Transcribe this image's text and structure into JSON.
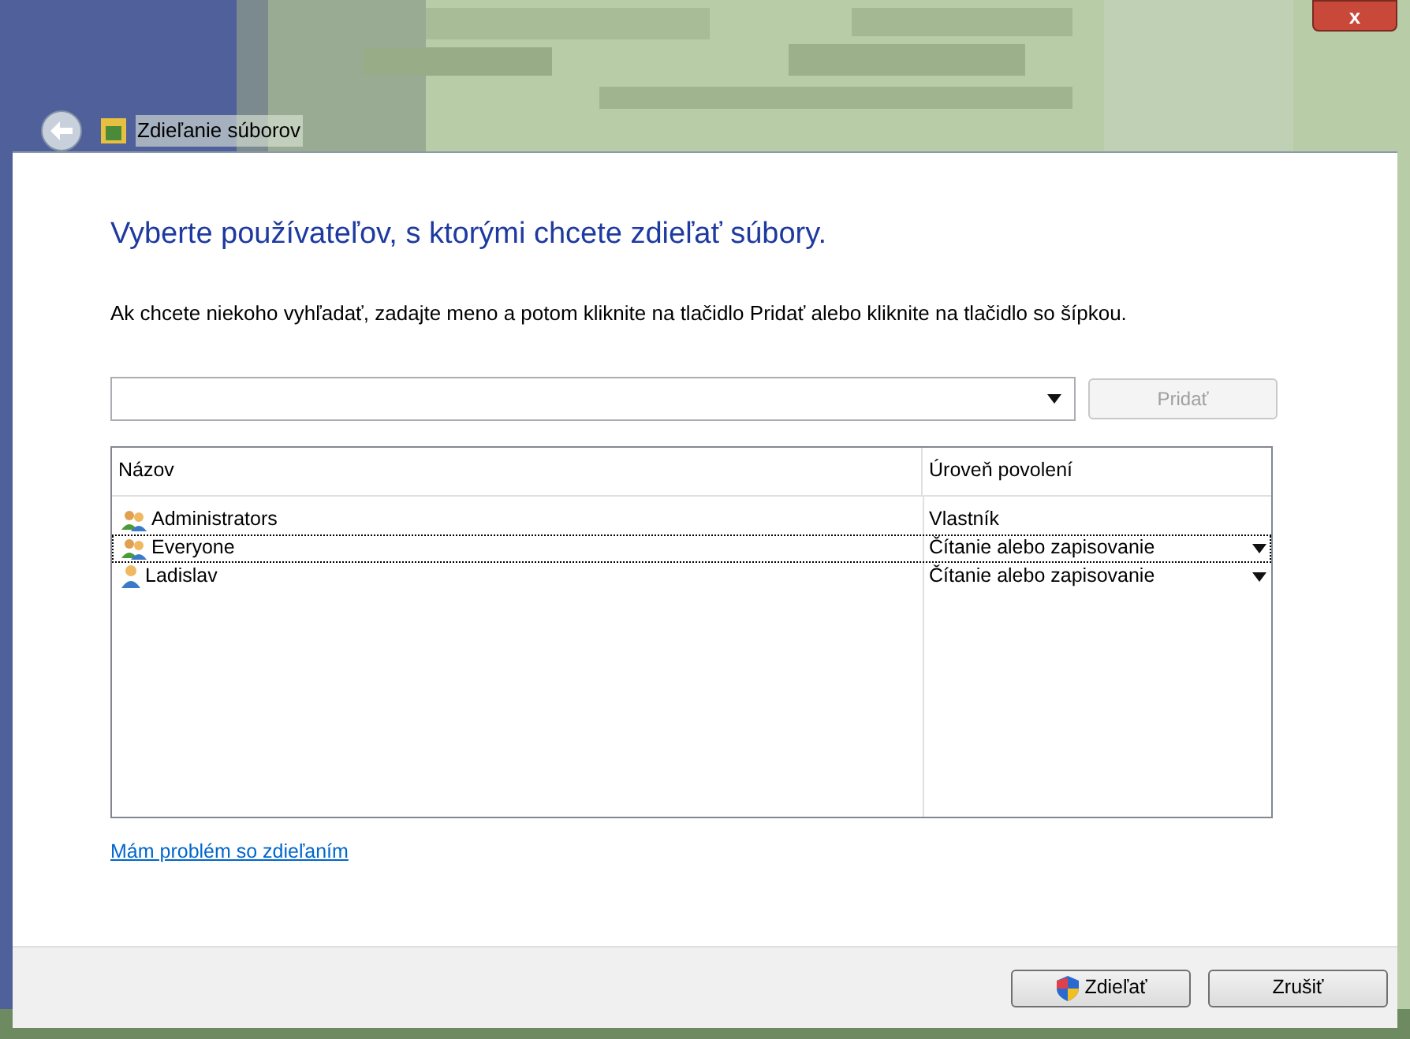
{
  "window": {
    "title": "Zdieľanie súborov",
    "close": "x"
  },
  "heading": "Vyberte používateľov, s ktorými chcete zdieľať súbory.",
  "instruction": "Ak chcete niekoho vyhľadať, zadajte meno a potom kliknite na tlačidlo Pridať alebo kliknite na tlačidlo so šípkou.",
  "add_button": {
    "label": "Pridať",
    "disabled": true
  },
  "table": {
    "columns": [
      "Názov",
      "Úroveň povolení"
    ],
    "rows": [
      {
        "name": "Administrators",
        "kind": "group",
        "permission": "Vlastník",
        "has_dropdown": false,
        "selected": false
      },
      {
        "name": "Everyone",
        "kind": "group",
        "permission": "Čítanie alebo zapisovanie",
        "has_dropdown": true,
        "selected": true
      },
      {
        "name": "Ladislav",
        "kind": "user",
        "permission": "Čítanie alebo zapisovanie",
        "has_dropdown": true,
        "selected": false
      }
    ]
  },
  "help_link": "Mám problém so zdieľaním",
  "buttons": [
    {
      "label": "Zdieľať",
      "kind": "shield"
    },
    {
      "label": "Zrušiť",
      "kind": "plain"
    }
  ]
}
